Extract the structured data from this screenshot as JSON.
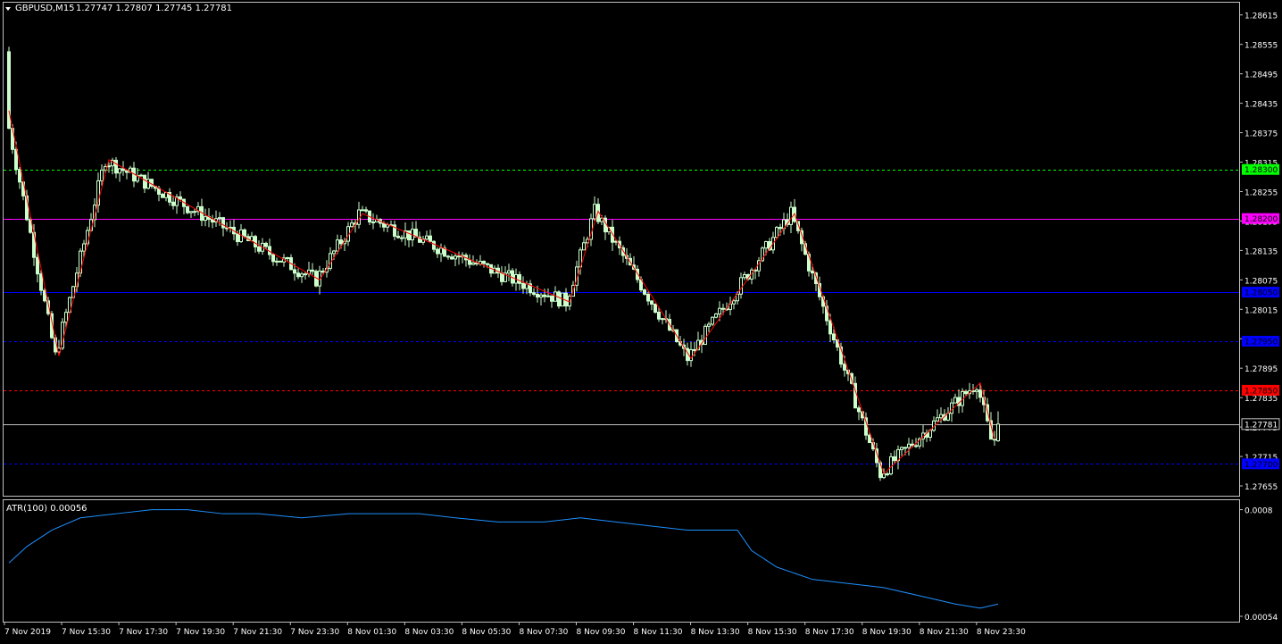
{
  "header": {
    "symbol": "GBPUSD,M15",
    "ohlc": "1.27747 1.27807 1.27745 1.27781",
    "indicator": "ATR(100) 0.00056"
  },
  "colors": {
    "background": "#000000",
    "frame": "#c0c0c0",
    "candle": "#ccffcc",
    "zigzag": "#ff0000",
    "atr_line": "#1e90ff",
    "level_green": "#00ff00",
    "level_magenta": "#ff00ff",
    "level_blue": "#0000ff",
    "level_red": "#ff0000"
  },
  "chart_data": [
    {
      "type": "candlestick",
      "title": "GBPUSD,M15",
      "ylim": [
        1.27635,
        1.2864
      ],
      "y_ticks": [
        "1.28615",
        "1.28555",
        "1.28495",
        "1.28435",
        "1.28375",
        "1.28315",
        "1.28255",
        "1.28195",
        "1.28135",
        "1.28075",
        "1.28015",
        "1.27955",
        "1.27895",
        "1.27835",
        "1.27775",
        "1.27715",
        "1.27655"
      ],
      "price_levels": [
        {
          "price": 1.283,
          "label": "1.28300",
          "style": "dashed",
          "color": "#00ff00"
        },
        {
          "price": 1.282,
          "label": "1.28200",
          "style": "solid",
          "color": "#ff00ff"
        },
        {
          "price": 1.2805,
          "label": "1.28050",
          "style": "solid",
          "color": "#0000ff"
        },
        {
          "price": 1.2795,
          "label": "1.27950",
          "style": "dashed",
          "color": "#0000ff"
        },
        {
          "price": 1.2785,
          "label": "1.27850",
          "style": "dashed",
          "color": "#ff0000"
        },
        {
          "price": 1.27781,
          "label": "1.27781",
          "style": "solid",
          "color": "#c0c0c0"
        },
        {
          "price": 1.277,
          "label": "1.27700",
          "style": "dashed",
          "color": "#0000ff"
        }
      ],
      "zigzag": [
        {
          "bar": 0,
          "price": 1.2842
        },
        {
          "bar": 14,
          "price": 1.2792
        },
        {
          "bar": 28,
          "price": 1.2832
        },
        {
          "bar": 87,
          "price": 1.28075
        },
        {
          "bar": 99,
          "price": 1.2821
        },
        {
          "bar": 157,
          "price": 1.2803
        },
        {
          "bar": 165,
          "price": 1.28215
        },
        {
          "bar": 191,
          "price": 1.27915
        },
        {
          "bar": 220,
          "price": 1.2821
        },
        {
          "bar": 245,
          "price": 1.2768
        },
        {
          "bar": 272,
          "price": 1.27865
        },
        {
          "bar": 276,
          "price": 1.2775
        }
      ],
      "x_tick_labels": [
        "7 Nov 2019",
        "7 Nov 15:30",
        "7 Nov 17:30",
        "7 Nov 19:30",
        "7 Nov 21:30",
        "7 Nov 23:30",
        "8 Nov 01:30",
        "8 Nov 03:30",
        "8 Nov 05:30",
        "8 Nov 07:30",
        "8 Nov 09:30",
        "8 Nov 11:30",
        "8 Nov 13:30",
        "8 Nov 15:30",
        "8 Nov 17:30",
        "8 Nov 19:30",
        "8 Nov 21:30",
        "8 Nov 23:30"
      ],
      "candles": {
        "count": 278,
        "last_ohlc": [
          1.27747,
          1.27807,
          1.27745,
          1.27781
        ]
      }
    },
    {
      "type": "line",
      "title": "ATR(100) 0.00056",
      "ylim": [
        0.00054,
        0.00081
      ],
      "y_ticks": [
        "0.0008",
        "0.00054"
      ],
      "points": [
        {
          "bar": 0,
          "value": 0.00067
        },
        {
          "bar": 5,
          "value": 0.00071
        },
        {
          "bar": 12,
          "value": 0.00075
        },
        {
          "bar": 20,
          "value": 0.00078
        },
        {
          "bar": 30,
          "value": 0.00079
        },
        {
          "bar": 40,
          "value": 0.0008
        },
        {
          "bar": 50,
          "value": 0.0008
        },
        {
          "bar": 60,
          "value": 0.00079
        },
        {
          "bar": 70,
          "value": 0.00079
        },
        {
          "bar": 82,
          "value": 0.00078
        },
        {
          "bar": 95,
          "value": 0.00079
        },
        {
          "bar": 105,
          "value": 0.00079
        },
        {
          "bar": 115,
          "value": 0.00079
        },
        {
          "bar": 125,
          "value": 0.00078
        },
        {
          "bar": 137,
          "value": 0.00077
        },
        {
          "bar": 150,
          "value": 0.00077
        },
        {
          "bar": 160,
          "value": 0.00078
        },
        {
          "bar": 170,
          "value": 0.00077
        },
        {
          "bar": 180,
          "value": 0.00076
        },
        {
          "bar": 190,
          "value": 0.00075
        },
        {
          "bar": 200,
          "value": 0.00075
        },
        {
          "bar": 204,
          "value": 0.00075
        },
        {
          "bar": 208,
          "value": 0.0007
        },
        {
          "bar": 215,
          "value": 0.00066
        },
        {
          "bar": 225,
          "value": 0.00063
        },
        {
          "bar": 235,
          "value": 0.00062
        },
        {
          "bar": 245,
          "value": 0.00061
        },
        {
          "bar": 255,
          "value": 0.00059
        },
        {
          "bar": 265,
          "value": 0.00057
        },
        {
          "bar": 272,
          "value": 0.00056
        },
        {
          "bar": 277,
          "value": 0.00057
        }
      ]
    }
  ]
}
